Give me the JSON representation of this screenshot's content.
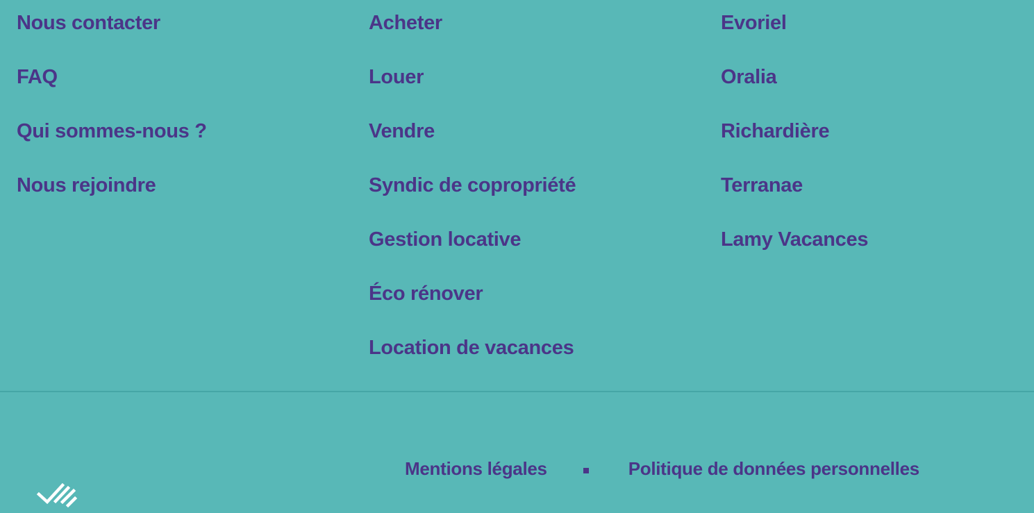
{
  "footer": {
    "columns": [
      {
        "items": [
          {
            "label": "Nous contacter"
          },
          {
            "label": "FAQ"
          },
          {
            "label": "Qui sommes-nous ?"
          },
          {
            "label": "Nous rejoindre"
          }
        ]
      },
      {
        "items": [
          {
            "label": "Acheter"
          },
          {
            "label": "Louer"
          },
          {
            "label": "Vendre"
          },
          {
            "label": "Syndic de copropriété"
          },
          {
            "label": "Gestion locative"
          },
          {
            "label": "Éco rénover"
          },
          {
            "label": "Location de vacances"
          }
        ]
      },
      {
        "items": [
          {
            "label": "Evoriel"
          },
          {
            "label": "Oralia"
          },
          {
            "label": "Richardière"
          },
          {
            "label": "Terranae"
          },
          {
            "label": "Lamy Vacances"
          }
        ]
      }
    ],
    "bottom": {
      "legal_label": "Mentions légales",
      "privacy_label": "Politique de données personnelles"
    },
    "logo_icon": "check-stripes-logo-icon"
  },
  "colors": {
    "background": "#58b8b7",
    "text": "#4b3588",
    "divider": "#45a6a6",
    "logo": "#ffffff"
  }
}
